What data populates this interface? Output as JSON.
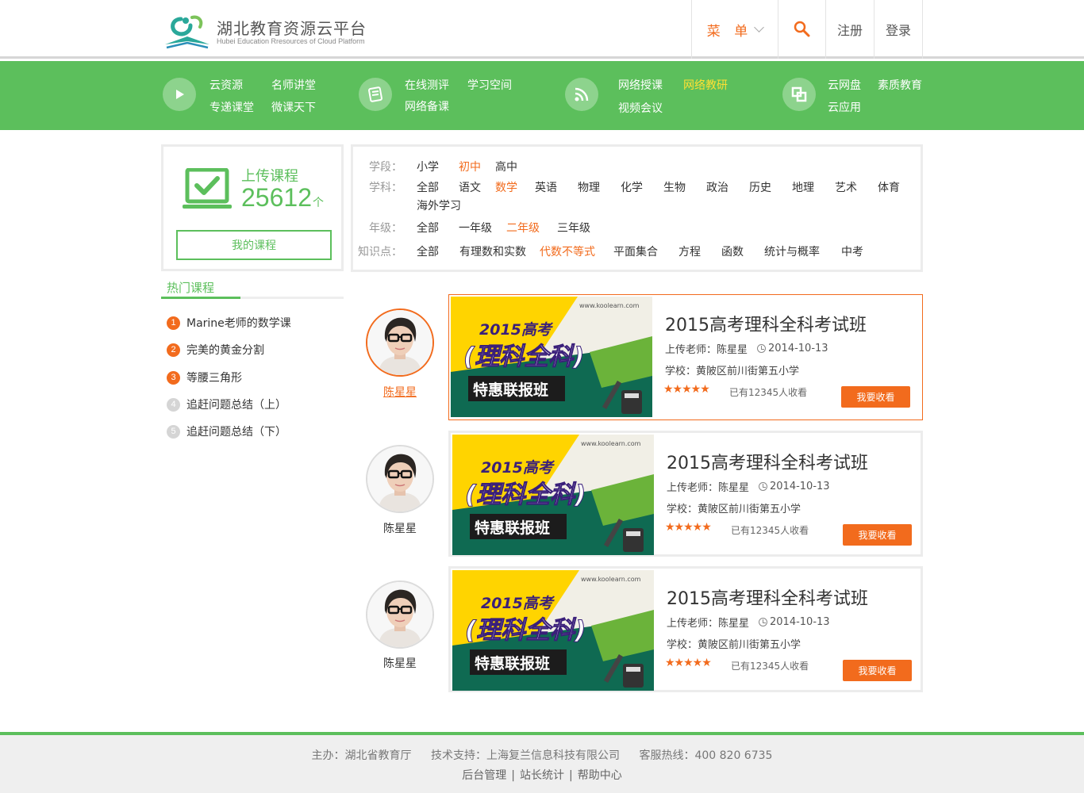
{
  "header": {
    "title": "湖北教育资源云平台",
    "subtitle": "Hubei Education Rresources of Cloud Platform",
    "menu_label": "菜 单",
    "register_label": "注册",
    "login_label": "登录"
  },
  "nav": {
    "group1": [
      "云资源",
      "名师讲堂",
      "专递课堂",
      "微课天下"
    ],
    "group2": [
      "在线测评",
      "学习空间",
      "网络备课"
    ],
    "group3": [
      "网络授课",
      "网络教研",
      "视频会议"
    ],
    "group4": [
      "云网盘",
      "素质教育",
      "云应用"
    ],
    "active": "网络教研"
  },
  "upload": {
    "title": "上传课程",
    "count": "25612",
    "unit": "个",
    "my_course_label": "我的课程"
  },
  "filter": {
    "stage_label": "学段：",
    "stages": [
      "小学",
      "初中",
      "高中"
    ],
    "subject_label": "学科：",
    "subjects": [
      "全部",
      "语文",
      "数学",
      "英语",
      "物理",
      "化学",
      "生物",
      "政治",
      "历史",
      "地理",
      "艺术",
      "体育",
      "海外学习"
    ],
    "grade_label": "年级：",
    "grades": [
      "全部",
      "一年级",
      "二年级",
      "三年级"
    ],
    "point_label": "知识点：",
    "points": [
      "全部",
      "有理数和实数",
      "代数不等式",
      "平面集合",
      "方程",
      "函数",
      "统计与概率",
      "中考"
    ]
  },
  "hot": {
    "title": "热门课程",
    "items": [
      {
        "num": "1",
        "text": "Marine老师的数学课"
      },
      {
        "num": "2",
        "text": "完美的黄金分割"
      },
      {
        "num": "3",
        "text": "等腰三角形"
      },
      {
        "num": "4",
        "text": "追赶问题总结（上）"
      },
      {
        "num": "5",
        "text": "追赶问题总结（下）"
      }
    ]
  },
  "courses": [
    {
      "teacher": "陈星星",
      "title": "2015高考理科全科考试班",
      "teacher_line": "上传老师：陈星星",
      "date": "2014-10-13",
      "school": "学校：黄陂区前川街第五小学",
      "stars": "★★★★★",
      "collected": "已有12345人收看",
      "button": "我要收看"
    },
    {
      "teacher": "陈星星",
      "title": "2015高考理科全科考试班",
      "teacher_line": "上传老师：陈星星",
      "date": "2014-10-13",
      "school": "学校：黄陂区前川街第五小学",
      "stars": "★★★★★",
      "collected": "已有12345人收看",
      "button": "我要收看"
    },
    {
      "teacher": "陈星星",
      "title": "2015高考理科全科考试班",
      "teacher_line": "上传老师：陈星星",
      "date": "2014-10-13",
      "school": "学校：黄陂区前川街第五小学",
      "stars": "★★★★★",
      "collected": "已有12345人收看",
      "button": "我要收看"
    }
  ],
  "banner": {
    "url": "www.koolearn.com",
    "line1": "2015高考",
    "line2": "(理科全科)",
    "line3": "特惠联报班"
  },
  "footer": {
    "host": "主办：湖北省教育厅",
    "support": "技术支持：上海复兰信息科技有限公司",
    "hotline": "客服热线：400 820 6735",
    "links": [
      "后台管理",
      "站长统计",
      "帮助中心"
    ]
  },
  "colors": {
    "green": "#5cbf5c",
    "orange": "#f26b1d",
    "yellow": "#ffe033"
  }
}
